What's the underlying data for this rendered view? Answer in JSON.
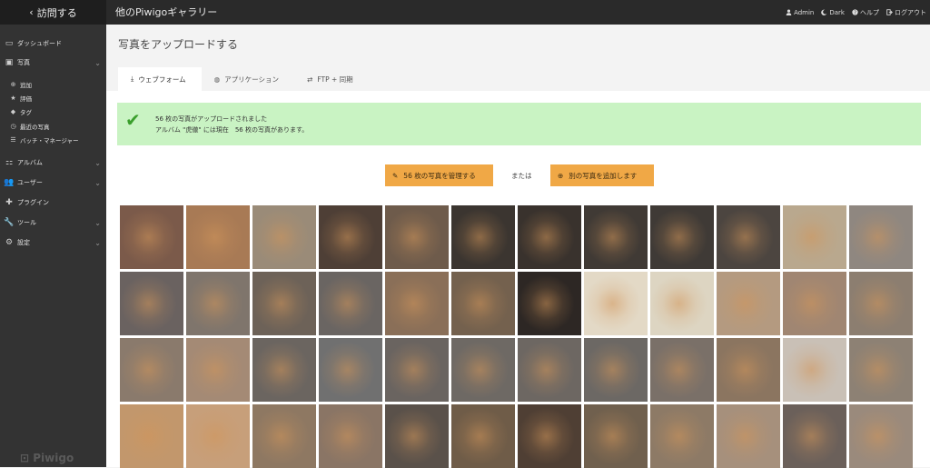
{
  "topbar": {
    "visit_label": "訪問する",
    "gallery_title": "他のPiwigoギャラリー",
    "admin_label": "Admin",
    "dark_label": "Dark",
    "help_label": "ヘルプ",
    "logout_label": "ログアウト"
  },
  "sidebar": {
    "items": [
      {
        "icon": "monitor-icon",
        "label": "ダッシュボード"
      },
      {
        "icon": "image-icon",
        "label": "写真"
      },
      {
        "icon": "users-icon",
        "label": "アルバム"
      },
      {
        "icon": "user-icon",
        "label": "ユーザー"
      },
      {
        "icon": "puzzle-icon",
        "label": "プラグイン"
      },
      {
        "icon": "wrench-icon",
        "label": "ツール"
      },
      {
        "icon": "gear-icon",
        "label": "設定"
      }
    ],
    "photo_sub": [
      {
        "icon": "plus-circle-icon",
        "label": "追加"
      },
      {
        "icon": "star-icon",
        "label": "評価"
      },
      {
        "icon": "tag-icon",
        "label": "タグ"
      },
      {
        "icon": "clock-icon",
        "label": "最近の写真"
      },
      {
        "icon": "list-icon",
        "label": "バッチ・マネージャー"
      }
    ],
    "logo": "Piwigo"
  },
  "main": {
    "page_title": "写真をアップロードする",
    "tabs": [
      {
        "icon": "upload-icon",
        "label": "ウェブフォーム"
      },
      {
        "icon": "globe-icon",
        "label": "アプリケーション"
      },
      {
        "icon": "sync-icon",
        "label": "FTP + 同期"
      }
    ],
    "alert": {
      "line1": "56 枚の写真がアップロードされました",
      "line2": "アルバム \"虎徹\" には現在　56 枚の写真があります。"
    },
    "manage_button": "56 枚の写真を管理する",
    "or_text": "または",
    "add_button": "別の写真を追加します"
  },
  "thumbs": [
    "#7b5a4a",
    "#a87a55",
    "#9a8b78",
    "#4e3f36",
    "#6e5b4b",
    "#3b3530",
    "#39322d",
    "#403a35",
    "#3f3a36",
    "#4c4540",
    "#b9a88e",
    "#8f8780",
    "#6a6260",
    "#7f756c",
    "#6d6258",
    "#6a6562",
    "#8a6f58",
    "#74614e",
    "#2d2724",
    "#e3d9c6",
    "#ddd5c2",
    "#b49a80",
    "#a08672",
    "#8c7e70",
    "#8a7a6c",
    "#a48a75",
    "#6b6560",
    "#707070",
    "#6a6460",
    "#6e6964",
    "#6d6762",
    "#6c6864",
    "#7a7068",
    "#8b7560",
    "#c9c0b6",
    "#8d8174",
    "#c2976c",
    "#c79f7a",
    "#8e7862",
    "#8a7565",
    "#5a514a",
    "#6f5c48",
    "#4f3f34",
    "#70604e",
    "#8d7a66",
    "#a6907c",
    "#6b605a",
    "#9a8a7c"
  ]
}
